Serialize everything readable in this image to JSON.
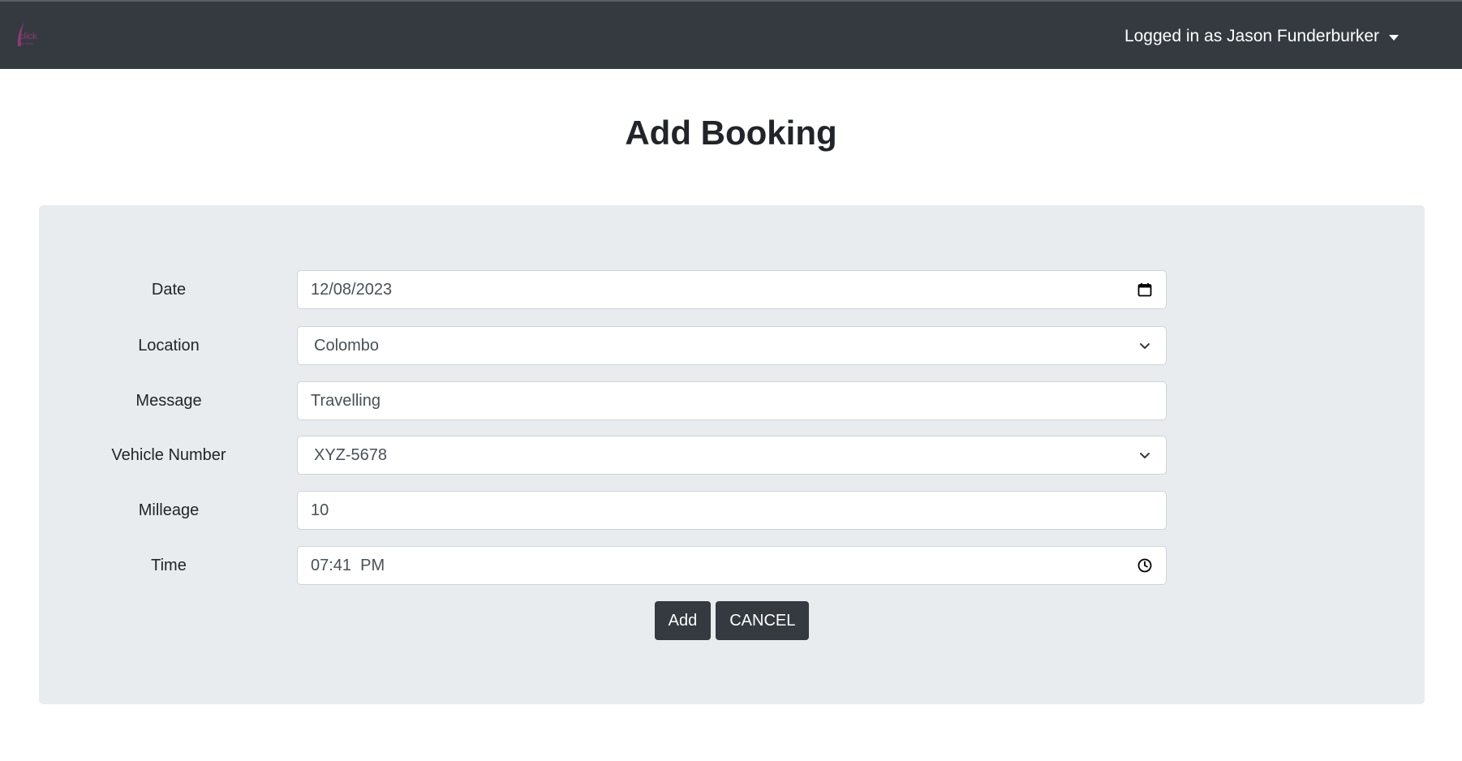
{
  "navbar": {
    "logo_text": "click",
    "logo_subtext": "car rental",
    "user_label": "Logged in as Jason Funderburker"
  },
  "page": {
    "title": "Add Booking"
  },
  "form": {
    "date": {
      "label": "Date",
      "value": "12/08/2023"
    },
    "location": {
      "label": "Location",
      "value": "Colombo"
    },
    "message": {
      "label": "Message",
      "value": "Travelling"
    },
    "vehicle": {
      "label": "Vehicle Number",
      "value": "XYZ-5678"
    },
    "mileage": {
      "label": "Milleage",
      "value": "10"
    },
    "time": {
      "label": "Time",
      "value": "07:41  PM"
    },
    "add_label": "Add",
    "cancel_label": "CANCEL"
  },
  "colors": {
    "navbar_bg": "#343a40",
    "card_bg": "#e9ecef",
    "button_bg": "#343a40",
    "logo_accent": "#8e3a78"
  },
  "icons": {
    "date": "calendar-icon",
    "location": "chevron-down-icon",
    "vehicle": "chevron-down-icon",
    "time": "clock-icon",
    "user_menu": "caret-down-icon"
  }
}
